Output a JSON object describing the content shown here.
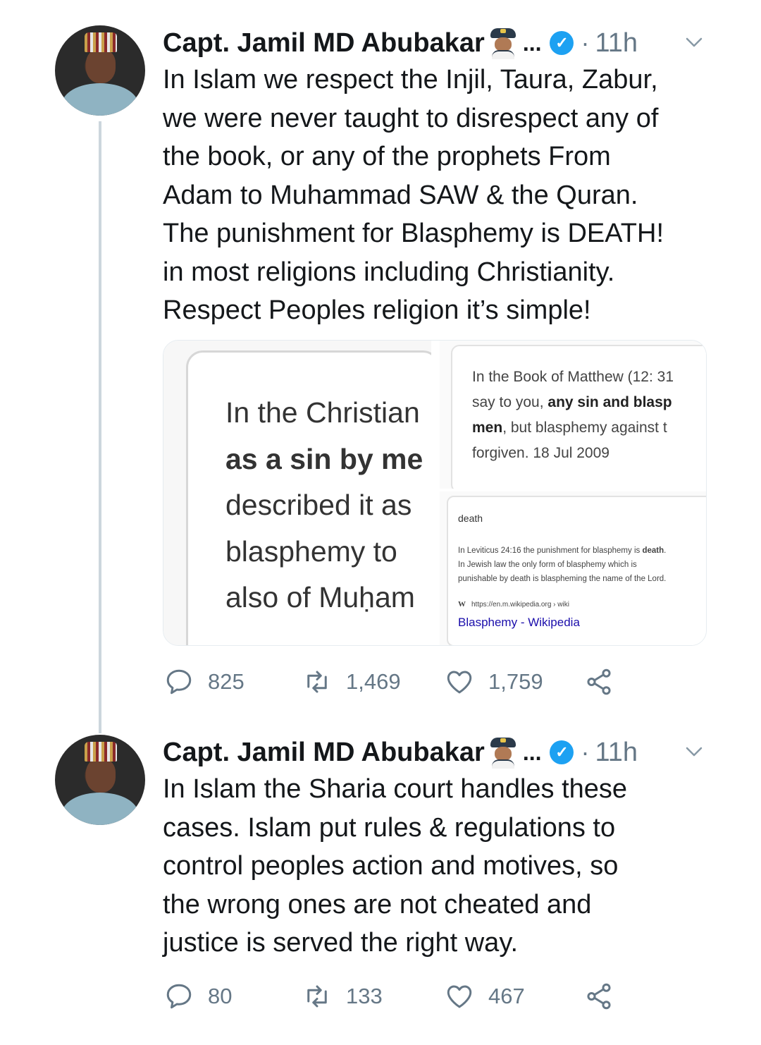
{
  "tweets": [
    {
      "author": "Capt. Jamil MD Abubakar",
      "ellipsis": "...",
      "dot": "·",
      "time": "11h",
      "lines": [
        "In Islam we respect the Injil, Taura, Zabur,",
        "we were never taught to disrespect any of",
        "the book, or any of the prophets From",
        "Adam to Muhammad SAW & the Quran.",
        "The punishment for Blasphemy is DEATH!",
        "in most religions including Christianity.",
        "Respect Peoples religion it’s simple!"
      ],
      "media": {
        "left": {
          "line1": "In the Christian",
          "line2": "as a sin by me",
          "line3": "described it as",
          "line4": "blasphemy to",
          "line5": "also of Muḥam"
        },
        "right_top": {
          "line1": "In the Book of Matthew (12: 31",
          "line2_plain": "say to you, ",
          "line2_bold": "any sin and blasp",
          "line3_bold": "men",
          "line3_plain": ", but blasphemy against t",
          "line4": "forgiven.  18 Jul 2009"
        },
        "right_bottom": {
          "word": "death",
          "line1_plain": "In Leviticus 24:16 the punishment for blasphemy is ",
          "line1_bold": "death",
          "line1_end": ".",
          "line2": "In Jewish law the only form of blasphemy which is",
          "line3": "punishable by death is blaspheming the name of the Lord.",
          "source_w": "W",
          "source_url": "https://en.m.wikipedia.org › wiki",
          "link": "Blasphemy - Wikipedia"
        }
      },
      "stats": {
        "replies": "825",
        "retweets": "1,469",
        "likes": "1,759"
      }
    },
    {
      "author": "Capt. Jamil MD Abubakar",
      "ellipsis": "...",
      "dot": "·",
      "time": "11h",
      "lines": [
        "In Islam the Sharia court handles these",
        "cases. Islam put rules & regulations to",
        "control peoples action and motives, so",
        "the wrong ones are not cheated and",
        "justice is served the right way."
      ],
      "stats": {
        "replies": "80",
        "retweets": "133",
        "likes": "467"
      }
    }
  ],
  "icons": {
    "verified": "verified-badge-icon",
    "pilot": "pilot-emoji-icon",
    "chevron": "chevron-down-icon",
    "reply": "reply-icon",
    "retweet": "retweet-icon",
    "like": "heart-icon",
    "share": "share-icon"
  },
  "colors": {
    "accent": "#1da1f2",
    "muted": "#657786",
    "text": "#14171a",
    "link": "#1a0dab"
  }
}
